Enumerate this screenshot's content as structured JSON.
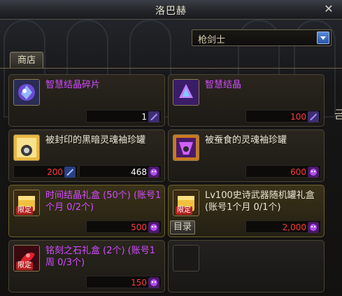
{
  "window": {
    "title": "洛巴赫"
  },
  "job_select": {
    "value": "枪剑士"
  },
  "tabs": [
    {
      "label": "商店"
    }
  ],
  "items": [
    {
      "name": "智慧结晶碎片",
      "name_color": "purple",
      "limited": false,
      "prices": [
        {
          "value": "1",
          "color": "white",
          "currency": "crystal-currency-icon"
        }
      ]
    },
    {
      "name": "智慧结晶",
      "name_color": "purple",
      "limited": false,
      "prices": [
        {
          "value": "100",
          "color": "red",
          "currency": "crystal-currency-icon"
        }
      ]
    },
    {
      "name": "被封印的黑暗灵魂袖珍罐",
      "name_color": "white",
      "limited": false,
      "prices": [
        {
          "value": "200",
          "color": "red",
          "currency": "crystal-currency-icon"
        },
        {
          "value": "468",
          "color": "white",
          "currency": "soul-currency-icon"
        }
      ]
    },
    {
      "name": "被蚕食的灵魂袖珍罐",
      "name_color": "white",
      "limited": false,
      "prices": [
        {
          "value": "600",
          "color": "red",
          "currency": "soul-currency-icon"
        }
      ]
    },
    {
      "name": "时间结晶礼盒 (50个) (账号1个月 0/2个)",
      "name_color": "purple",
      "limited": true,
      "limited_label": "限定",
      "prices": [
        {
          "value": "500",
          "color": "red",
          "currency": "soul-currency-icon"
        }
      ]
    },
    {
      "name": "Lv100史诗武器随机罐礼盒(账号1个月 0/1个)",
      "name_color": "white",
      "limited": true,
      "limited_label": "限定",
      "catalog_label": "目录",
      "prices": [
        {
          "value": "2,000",
          "color": "red",
          "currency": "soul-currency-icon"
        }
      ]
    },
    {
      "name": "铭刻之石礼盒 (2个) (账号1周 0/3个)",
      "name_color": "purple",
      "limited": true,
      "limited_label": "限定",
      "prices": [
        {
          "value": "150",
          "color": "red",
          "currency": "soul-currency-icon"
        }
      ]
    }
  ],
  "side_glyph": "금",
  "colors": {
    "purple": "#d24cff",
    "red": "#ff3b3b",
    "accent_blue": "#2a56a6"
  }
}
